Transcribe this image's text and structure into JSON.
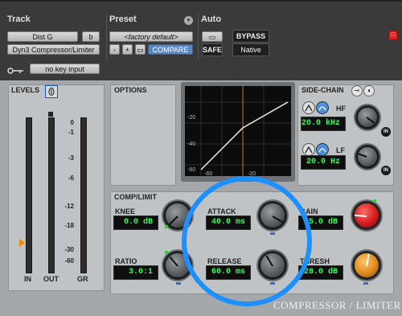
{
  "header": {
    "track_label": "Track",
    "preset_label": "Preset",
    "auto_label": "Auto",
    "track_name": "Dist G",
    "track_channel": "b",
    "plugin_name": "Dyn3 Compressor/Limiter",
    "preset_value": "<factory default>",
    "minus_label": "-",
    "plus_label": "+",
    "compare_label": "COMPARE",
    "safe_label": "SAFE",
    "bypass_label": "BYPASS",
    "native_label": "Native",
    "key_input_label": "no key input"
  },
  "levels": {
    "title": "LEVELS",
    "scale": [
      "0",
      "-1",
      "-3",
      "-6",
      "-12",
      "-18",
      "-30",
      "-60"
    ],
    "labels": [
      "IN",
      "OUT",
      "GR"
    ]
  },
  "options": {
    "title": "OPTIONS"
  },
  "graph": {
    "y_ticks": [
      "-20",
      "-40",
      "-60"
    ],
    "x_ticks": [
      "-60",
      "-20"
    ]
  },
  "sidechain": {
    "title": "SIDE-CHAIN",
    "hf_label": "HF",
    "hf_value": "20.0 kHz",
    "lf_label": "LF",
    "lf_value": "20.0 Hz",
    "in_label": "IN"
  },
  "comp": {
    "title": "COMP/LIMIT",
    "knee_label": "KNEE",
    "knee_value": "0.0 dB",
    "attack_label": "ATTACK",
    "attack_value": "40.0 ms",
    "gain_label": "GAIN",
    "gain_value": "5.0 dB",
    "ratio_label": "RATIO",
    "ratio_value": "3.0:1",
    "release_label": "RELEASE",
    "release_value": "60.0 ms",
    "thresh_label": "THRESH",
    "thresh_value": "-28.0 dB",
    "brand": "COMPRESSOR / LIMITER"
  },
  "colors": {
    "highlight_circle": "#1e8fff",
    "readout_text": "#36ff5a"
  }
}
